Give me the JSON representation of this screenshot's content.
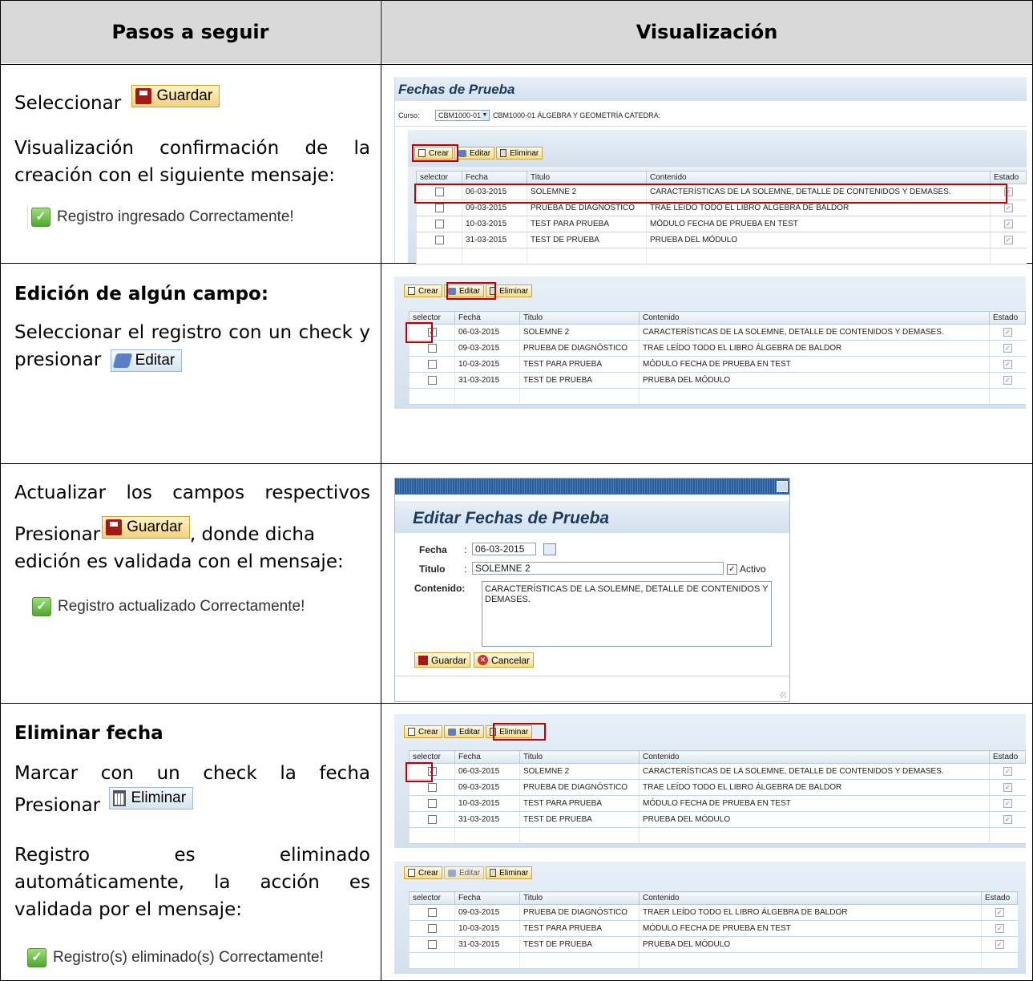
{
  "headers": {
    "left": "Pasos a seguir",
    "right": "Visualización"
  },
  "row1": {
    "text_select": "Seleccionar",
    "btn_guardar": "Guardar",
    "text_confirm": "Visualización confirmación de la creación con el siguiente mensaje:",
    "msg": "Registro ingresado Correctamente!"
  },
  "row2": {
    "title": "Edición de algún campo:",
    "text": "Seleccionar el registro con un check y presionar",
    "btn_editar": "Editar"
  },
  "row3": {
    "text1": "Actualizar los campos respectivos",
    "text_press": "Presionar",
    "btn_guardar": "Guardar",
    "text2": ", donde dicha",
    "text3": "edición es validada con el mensaje:",
    "msg": "Registro actualizado Correctamente!"
  },
  "row4": {
    "title": "Eliminar fecha",
    "text1": "Marcar con un check la fecha",
    "text_press": "Presionar",
    "btn_eliminar": "Eliminar",
    "text2": "Registro es eliminado automáticamente, la acción es validada por el mensaje:",
    "msg": "Registro(s) eliminado(s) Correctamente!"
  },
  "sap": {
    "title": "Fechas de Prueba",
    "curso_label": "Curso:",
    "curso_value": "CBM1000-01",
    "curso_desc": "CBM1000-01 ÁLGEBRA Y GEOMETRÍA CATEDRA:",
    "btn_crear": "Crear",
    "btn_editar": "Editar",
    "btn_eliminar": "Eliminar",
    "columns": [
      "selector",
      "Fecha",
      "Titulo",
      "Contenido",
      "Estado"
    ],
    "rows": [
      {
        "fecha": "06-03-2015",
        "titulo": "SOLEMNE 2",
        "contenido": "CARACTERÍSTICAS DE LA SOLEMNE, DETALLE DE CONTENIDOS Y DEMASES."
      },
      {
        "fecha": "09-03-2015",
        "titulo": "PRUEBA DE DIAGNÓSTICO",
        "contenido": "TRAE LEÍDO TODO EL LIBRO ÁLGEBRA DE BALDOR"
      },
      {
        "fecha": "10-03-2015",
        "titulo": "TEST PARA PRUEBA",
        "contenido": "MÓDULO FECHA DE PRUEBA EN TEST"
      },
      {
        "fecha": "31-03-2015",
        "titulo": "TEST DE PRUEBA",
        "contenido": "PRUEBA DEL MÓDULO"
      }
    ],
    "rows_after_delete": [
      {
        "fecha": "09-03-2015",
        "titulo": "PRUEBA DE DIAGNÓSTICO",
        "contenido": "TRAER LEÍDO TODO EL LIBRO ÁLGEBRA DE BALDOR"
      },
      {
        "fecha": "10-03-2015",
        "titulo": "TEST PARA PRUEBA",
        "contenido": "MÓDULO FECHA DE PRUEBA EN TEST"
      },
      {
        "fecha": "31-03-2015",
        "titulo": "TEST DE PRUEBA",
        "contenido": "PRUEBA DEL MÓDULO"
      }
    ]
  },
  "edit_dialog": {
    "title": "Editar Fechas de Prueba",
    "fecha_label": "Fecha",
    "fecha_value": "06-03-2015",
    "titulo_label": "Titulo",
    "titulo_value": "SOLEMNE 2",
    "activo_label": "Activo",
    "contenido_label": "Contenido:",
    "contenido_value": "CARACTERÍSTICAS DE LA SOLEMNE, DETALLE DE CONTENIDOS Y DEMASES.",
    "btn_guardar": "Guardar",
    "btn_cancelar": "Cancelar"
  }
}
